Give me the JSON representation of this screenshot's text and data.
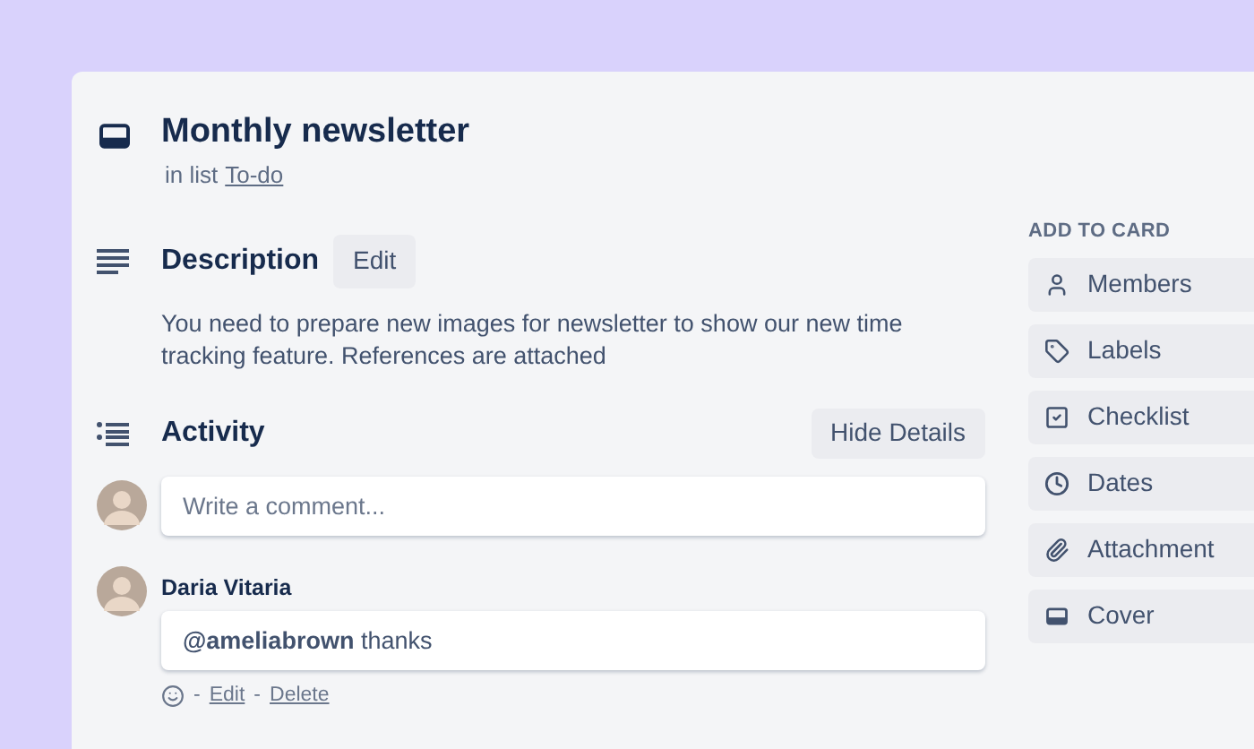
{
  "card": {
    "title": "Monthly newsletter",
    "list_prefix": "in list",
    "list_name": "To-do"
  },
  "description": {
    "heading": "Description",
    "edit_button": "Edit",
    "text": "You need to prepare new images for newsletter to show our new time tracking feature. References are attached"
  },
  "activity": {
    "heading": "Activity",
    "toggle_button": "Hide Details",
    "comment_placeholder": "Write a comment...",
    "comments": [
      {
        "author": "Daria Vitaria",
        "text": "**@ameliabrown** thanks",
        "separator": "-",
        "actions": [
          {
            "label": "Edit",
            "separator": "-"
          },
          {
            "label": "Delete"
          }
        ]
      }
    ]
  },
  "sidebar": {
    "heading": "ADD TO CARD",
    "items": [
      {
        "kind": "members",
        "label": "Members"
      },
      {
        "kind": "labels",
        "label": "Labels"
      },
      {
        "kind": "checklist",
        "label": "Checklist"
      },
      {
        "kind": "dates",
        "label": "Dates"
      },
      {
        "kind": "attachment",
        "label": "Attachment"
      },
      {
        "kind": "cover",
        "label": "Cover"
      }
    ]
  }
}
